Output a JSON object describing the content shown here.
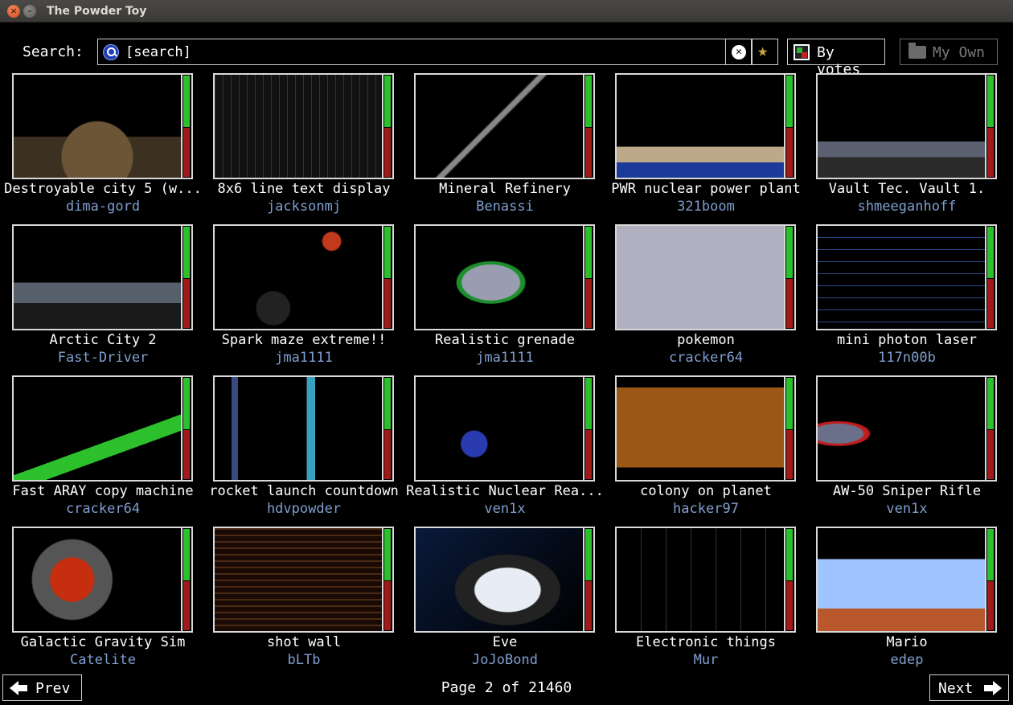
{
  "window": {
    "title": "The Powder Toy"
  },
  "search": {
    "label": "Search:",
    "value": "[search]"
  },
  "sort": {
    "label": "By votes"
  },
  "my_own": {
    "label": "My Own"
  },
  "saves": [
    {
      "title": "Destroyable city 5 (w...",
      "author": "dima-gord"
    },
    {
      "title": "8x6 line text display",
      "author": "jacksonmj"
    },
    {
      "title": "Mineral Refinery",
      "author": "Benassi"
    },
    {
      "title": "PWR nuclear power plant",
      "author": "321boom"
    },
    {
      "title": "Vault Tec. Vault 1.",
      "author": "shmeeganhoff"
    },
    {
      "title": "Arctic City 2",
      "author": "Fast-Driver"
    },
    {
      "title": "Spark maze extreme!!",
      "author": "jma1111"
    },
    {
      "title": "Realistic grenade",
      "author": "jma1111"
    },
    {
      "title": "pokemon",
      "author": "cracker64"
    },
    {
      "title": "mini photon laser",
      "author": "117n00b"
    },
    {
      "title": "Fast ARAY copy machine",
      "author": "cracker64"
    },
    {
      "title": "rocket launch countdown",
      "author": "hdvpowder"
    },
    {
      "title": "Realistic Nuclear Rea...",
      "author": "ven1x"
    },
    {
      "title": "colony on planet",
      "author": "hacker97"
    },
    {
      "title": "AW-50 Sniper Rifle",
      "author": "ven1x"
    },
    {
      "title": "Galactic Gravity Sim",
      "author": "Catelite"
    },
    {
      "title": "shot wall",
      "author": "bLTb"
    },
    {
      "title": "Eve",
      "author": "JoJoBond"
    },
    {
      "title": "Electronic things",
      "author": "Mur"
    },
    {
      "title": "Mario",
      "author": "edep"
    }
  ],
  "pagination": {
    "prev_label": "Prev",
    "next_label": "Next",
    "page_text": "Page 2 of 21460"
  },
  "colors": {
    "author": "#7f9fd0",
    "vote_up": "#2cc12c",
    "vote_down": "#a11a1a"
  }
}
